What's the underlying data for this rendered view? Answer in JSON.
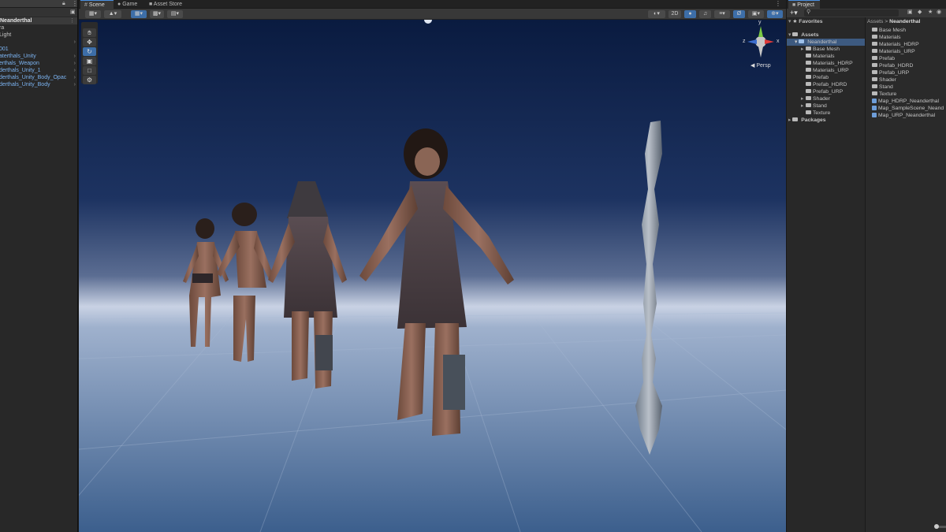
{
  "hierarchy": {
    "selected": "Neanderthal",
    "items": [
      {
        "label": "ra",
        "color": "normal",
        "arrow": false
      },
      {
        "label": "Light",
        "color": "normal",
        "arrow": false
      },
      {
        "label": "",
        "color": "normal",
        "arrow": true
      },
      {
        "label": "001",
        "color": "blue",
        "arrow": false
      },
      {
        "label": "aterthals_Unity",
        "color": "blue",
        "arrow": true
      },
      {
        "label": "erthals_Weapon",
        "color": "blue",
        "arrow": true
      },
      {
        "label": "derthals_Unity_1",
        "color": "blue",
        "arrow": true
      },
      {
        "label": "derthals_Unity_Body_Opac",
        "color": "blue",
        "arrow": true
      },
      {
        "label": "derthals_Unity_Body",
        "color": "blue",
        "arrow": true
      }
    ]
  },
  "scene": {
    "tabs": [
      {
        "label": "Scene",
        "icon": "hash-icon"
      },
      {
        "label": "Game",
        "icon": "gamepad-icon"
      },
      {
        "label": "Asset Store",
        "icon": "bag-icon"
      }
    ],
    "toolbar_2d": "2D",
    "gizmo_label": "Persp",
    "gizmo_axes": {
      "x": "x",
      "y": "y",
      "z": "z"
    }
  },
  "project": {
    "tab": "Project",
    "favorites": "Favorites",
    "assets": "Assets",
    "neanderthal": "Neanderthal",
    "tree_children": [
      "Base Mesh",
      "Materials",
      "Materials_HDRP",
      "Materials_URP",
      "Prefab",
      "Prefab_HDRD",
      "Prefab_URP",
      "Shader",
      "Stand",
      "Texture"
    ],
    "packages": "Packages",
    "breadcrumb": [
      "Assets",
      "Neanderthal"
    ],
    "files": [
      {
        "label": "Base Mesh",
        "kind": "folder"
      },
      {
        "label": "Materials",
        "kind": "folder"
      },
      {
        "label": "Materials_HDRP",
        "kind": "folder"
      },
      {
        "label": "Materials_URP",
        "kind": "folder"
      },
      {
        "label": "Prefab",
        "kind": "folder"
      },
      {
        "label": "Prefab_HDRD",
        "kind": "folder"
      },
      {
        "label": "Prefab_URP",
        "kind": "folder"
      },
      {
        "label": "Shader",
        "kind": "folder"
      },
      {
        "label": "Stand",
        "kind": "folder"
      },
      {
        "label": "Texture",
        "kind": "folder"
      },
      {
        "label": "Map_HDRP_Neanderthal",
        "kind": "scene"
      },
      {
        "label": "Map_SampleScene_Neand",
        "kind": "scene"
      },
      {
        "label": "Map_URP_Neanderthal",
        "kind": "scene"
      }
    ]
  },
  "colors": {
    "accent": "#3d6ea8",
    "scene_link": "#7cb4f2",
    "sky_top": "#0a1b40",
    "floor": "#5e7fa3"
  }
}
